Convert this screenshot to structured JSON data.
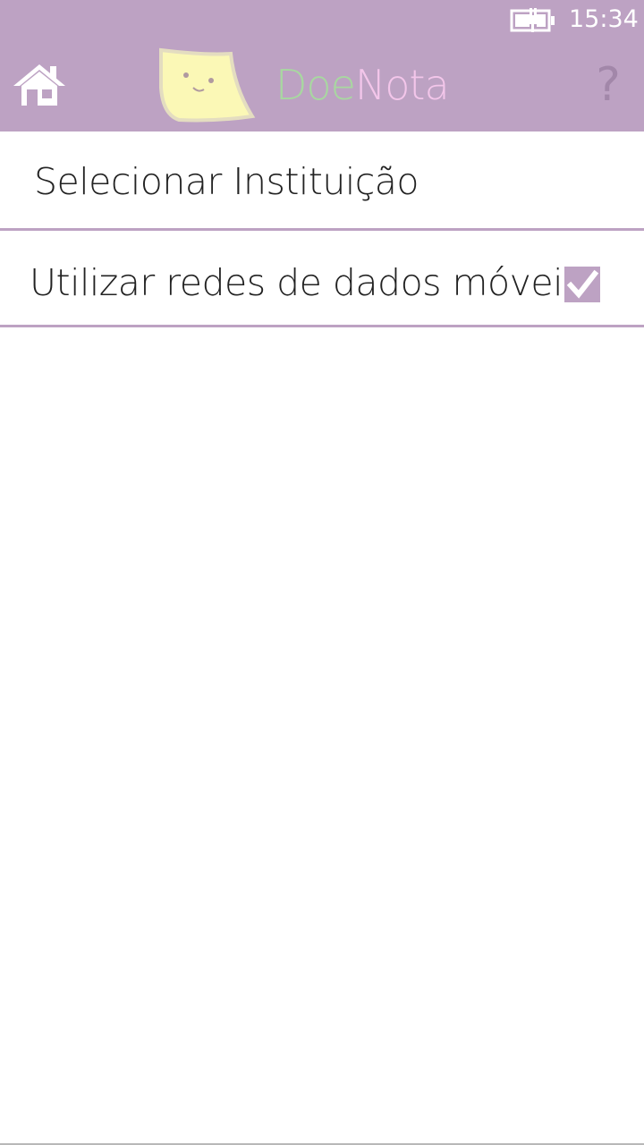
{
  "status_bar": {
    "time": "15:34",
    "battery_icon": "battery-charging-icon"
  },
  "header": {
    "home_icon": "home-icon",
    "logo_icon": "sticky-note-smiley-icon",
    "brand_part1": "Doe",
    "brand_part2": "Nota",
    "help_label": "?",
    "background_color": "#bda2c3",
    "brand_part1_color": "#a8d8a0",
    "brand_part2_color": "#f3c6ea"
  },
  "settings": {
    "items": [
      {
        "label": "Selecionar Instituição"
      },
      {
        "label": "Utilizar redes de dados móveis",
        "checked": true
      }
    ]
  }
}
